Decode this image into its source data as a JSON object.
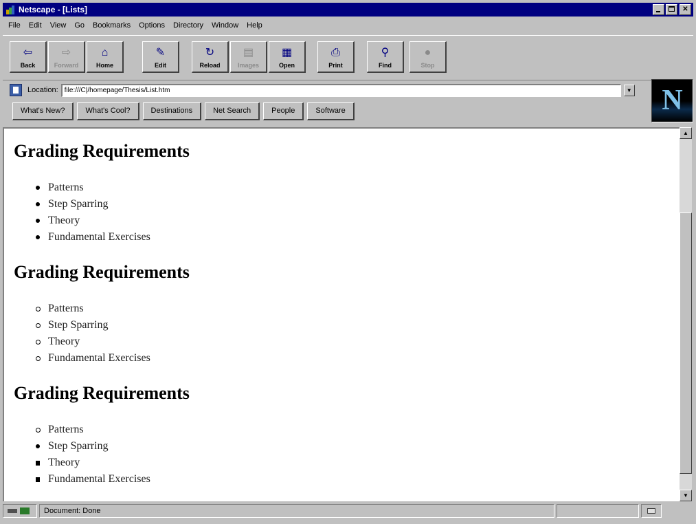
{
  "window": {
    "title": "Netscape - [Lists]"
  },
  "menu": [
    "File",
    "Edit",
    "View",
    "Go",
    "Bookmarks",
    "Options",
    "Directory",
    "Window",
    "Help"
  ],
  "toolbar": {
    "back": "Back",
    "forward": "Forward",
    "home": "Home",
    "edit": "Edit",
    "reload": "Reload",
    "images": "Images",
    "open": "Open",
    "print": "Print",
    "find": "Find",
    "stop": "Stop"
  },
  "location": {
    "label": "Location:",
    "url": "file:///C|/homepage/Thesis/List.htm"
  },
  "directory_buttons": [
    "What's New?",
    "What's Cool?",
    "Destinations",
    "Net Search",
    "People",
    "Software"
  ],
  "content": {
    "sections": [
      {
        "heading": "Grading Requirements",
        "items": [
          "Patterns",
          "Step Sparring",
          "Theory",
          "Fundamental Exercises"
        ]
      },
      {
        "heading": "Grading Requirements",
        "items": [
          "Patterns",
          "Step Sparring",
          "Theory",
          "Fundamental Exercises"
        ]
      },
      {
        "heading": "Grading Requirements",
        "items": [
          "Patterns",
          "Step Sparring",
          "Theory",
          "Fundamental Exercises"
        ]
      }
    ]
  },
  "status": {
    "text": "Document: Done"
  },
  "icons": {
    "back": "left-arrow-icon",
    "forward": "right-arrow-icon",
    "home": "house-icon",
    "edit": "pencil-icon",
    "reload": "reload-icon",
    "images": "images-icon",
    "open": "open-icon",
    "print": "printer-icon",
    "find": "binoculars-icon",
    "stop": "stop-icon"
  },
  "colors": {
    "title_bar": "#000080",
    "chrome": "#c0c0c0",
    "page": "#ffffff"
  }
}
